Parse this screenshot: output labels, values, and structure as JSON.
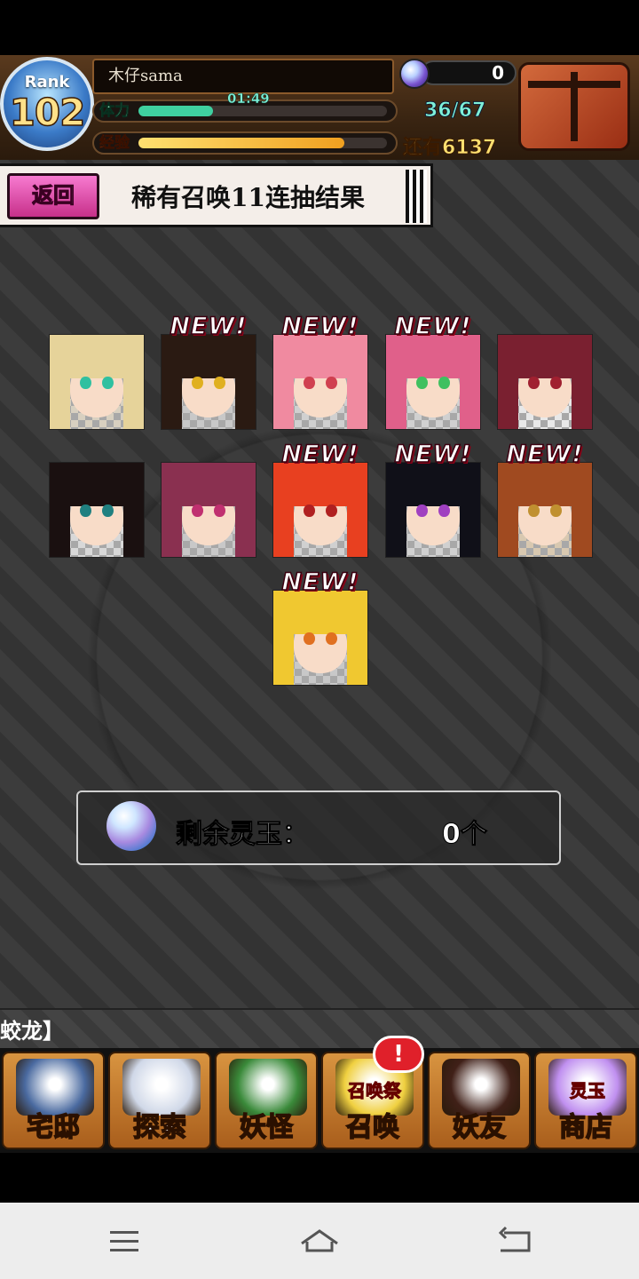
{
  "header": {
    "rank_label": "Rank",
    "rank_value": "102",
    "player_name": "木仔sama",
    "stamina_label": "体力",
    "stamina_timer": "01:49",
    "stamina_fill": 0.3,
    "stamina_value": "36/67",
    "exp_label": "经验",
    "exp_fill": 0.83,
    "exp_remaining": "还有6137",
    "orb_count": "0",
    "colors": {
      "stamina": "#3fd0a0",
      "exp": "#f0a020"
    }
  },
  "title_bar": {
    "back_label": "返回",
    "title": "稀有召唤11连抽结果"
  },
  "results": [
    {
      "new": false,
      "badge": "",
      "bg": "#d8d0c0",
      "hair": "#e6d39a",
      "eye": "#30c0a0"
    },
    {
      "new": true,
      "badge": "NEW!",
      "bg": "#c8c8c8",
      "hair": "#2a1a12",
      "eye": "#e0b020"
    },
    {
      "new": true,
      "badge": "NEW!",
      "bg": "#d0d0d0",
      "hair": "#f08aa0",
      "eye": "#d04050"
    },
    {
      "new": true,
      "badge": "NEW!",
      "bg": "#d0d0d0",
      "hair": "#e0608a",
      "eye": "#40c060"
    },
    {
      "new": false,
      "badge": "",
      "bg": "#e8e8e8",
      "hair": "#7a2030",
      "eye": "#a02030"
    },
    {
      "new": false,
      "badge": "",
      "bg": "#d8d8d8",
      "hair": "#1a1010",
      "eye": "#208080"
    },
    {
      "new": false,
      "badge": "",
      "bg": "#c8c8c8",
      "hair": "#8a3050",
      "eye": "#c03070"
    },
    {
      "new": true,
      "badge": "NEW!",
      "bg": "#d0d0d0",
      "hair": "#e84020",
      "eye": "#b02020"
    },
    {
      "new": true,
      "badge": "NEW!",
      "bg": "#d0d0d0",
      "hair": "#101018",
      "eye": "#a040c0"
    },
    {
      "new": true,
      "badge": "NEW!",
      "bg": "#d8c8b0",
      "hair": "#a04a20",
      "eye": "#c09030"
    },
    {
      "new": true,
      "badge": "NEW!",
      "bg": "#c8c8c8",
      "hair": "#f0c830",
      "eye": "#e07020"
    }
  ],
  "remaining": {
    "label": "剩余灵玉：",
    "value": "0个"
  },
  "ticker_text": "蛟龙】",
  "bottom_nav": [
    {
      "label": "宅邸",
      "icon": "mansion-icon",
      "color": "#4a6aa0"
    },
    {
      "label": "探索",
      "icon": "magnifier-map-icon",
      "color": "#d0d8e8"
    },
    {
      "label": "妖怪",
      "icon": "scroll-icon",
      "color": "#3a8a3a"
    },
    {
      "label": "召唤",
      "icon": "summon-star-icon",
      "color": "#f0d040",
      "sub": "召唤祭",
      "alert": "!"
    },
    {
      "label": "妖友",
      "icon": "catgirl-icon",
      "color": "#402018"
    },
    {
      "label": "商店",
      "icon": "orb-shop-icon",
      "color": "#c090f0",
      "sub": "灵玉"
    }
  ]
}
